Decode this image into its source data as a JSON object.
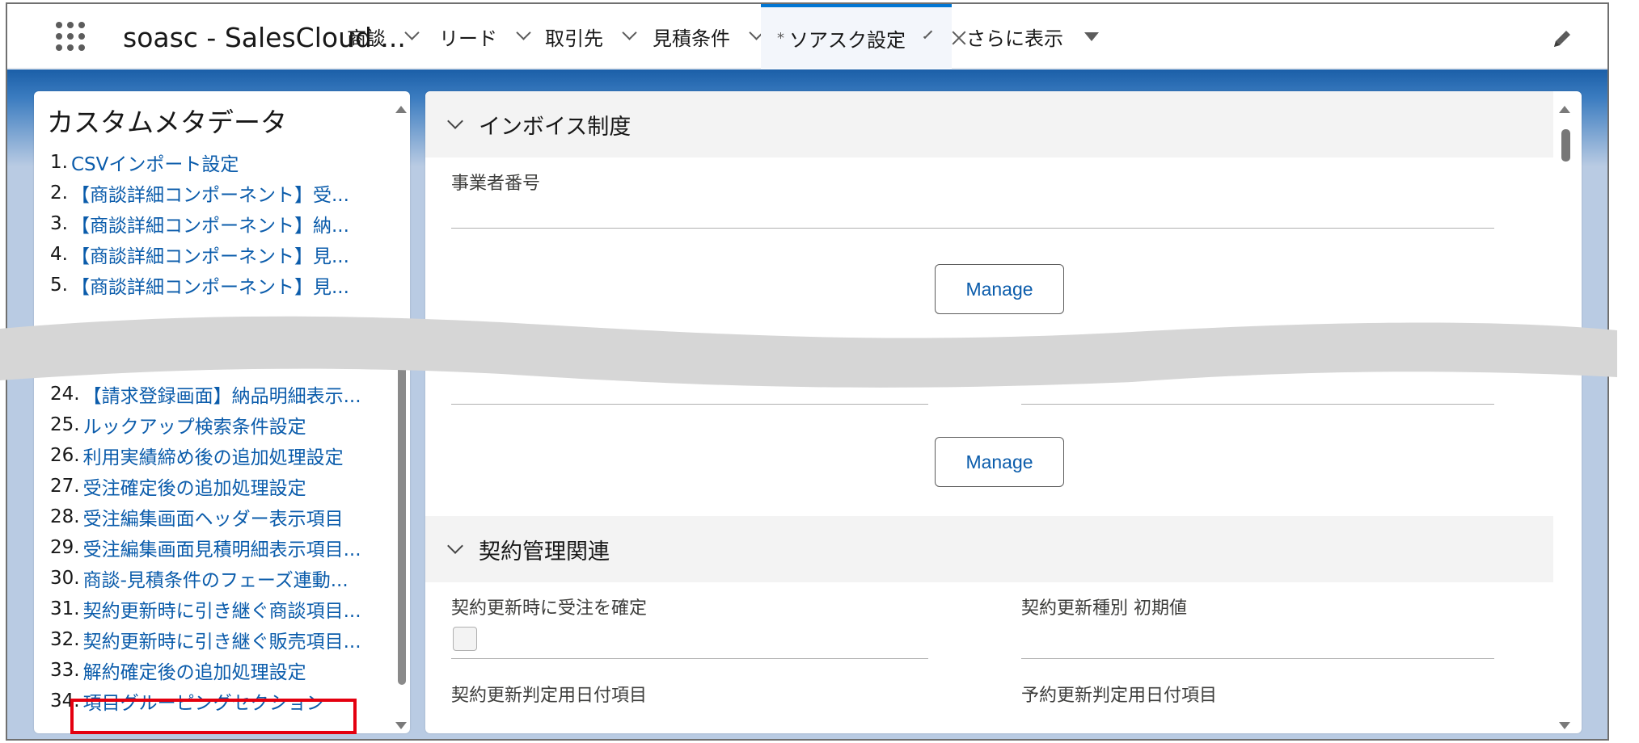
{
  "app": {
    "name": "soasc - SalesCloud ..."
  },
  "nav": {
    "tabs": [
      {
        "label": "商談"
      },
      {
        "label": "リード"
      },
      {
        "label": "取引先"
      },
      {
        "label": "見積条件"
      },
      {
        "label": "ソアスク設定",
        "modified_marker": "*"
      },
      {
        "label": "さらに表示"
      }
    ]
  },
  "left": {
    "title": "カスタムメタデータ",
    "items": [
      {
        "num": "1.",
        "label": "CSVインポート設定"
      },
      {
        "num": "2.",
        "label": "【商談詳細コンポーネント】受..."
      },
      {
        "num": "3.",
        "label": "【商談詳細コンポーネント】納..."
      },
      {
        "num": "4.",
        "label": "【商談詳細コンポーネント】見..."
      },
      {
        "num": "5.",
        "label": "【商談詳細コンポーネント】見..."
      },
      {
        "num": "24.",
        "label": "【請求登録画面】納品明細表示..."
      },
      {
        "num": "25.",
        "label": "ルックアップ検索条件設定"
      },
      {
        "num": "26.",
        "label": "利用実績締め後の追加処理設定"
      },
      {
        "num": "27.",
        "label": "受注確定後の追加処理設定"
      },
      {
        "num": "28.",
        "label": "受注編集画面ヘッダー表示項目"
      },
      {
        "num": "29.",
        "label": "受注編集画面見積明細表示項目..."
      },
      {
        "num": "30.",
        "label": "商談-見積条件のフェーズ連動..."
      },
      {
        "num": "31.",
        "label": "契約更新時に引き継ぐ商談項目..."
      },
      {
        "num": "32.",
        "label": "契約更新時に引き継ぐ販売項目..."
      },
      {
        "num": "33.",
        "label": "解約確定後の追加処理設定"
      },
      {
        "num": "34.",
        "label": "項目グルーピングセクション"
      }
    ]
  },
  "right": {
    "section1": {
      "title": "インボイス制度",
      "field1_label": "事業者番号",
      "manage1": "Manage",
      "manage2": "Manage"
    },
    "section2": {
      "title": "契約管理関連",
      "field_confirm": "契約更新時に受注を確定",
      "field_type": "契約更新種別 初期値",
      "field_date1": "契約更新判定用日付項目",
      "field_date2": "予約更新判定用日付項目"
    }
  },
  "colors": {
    "accent": "#0176d3",
    "link": "#0b5cab",
    "highlight": "#e4000f"
  }
}
